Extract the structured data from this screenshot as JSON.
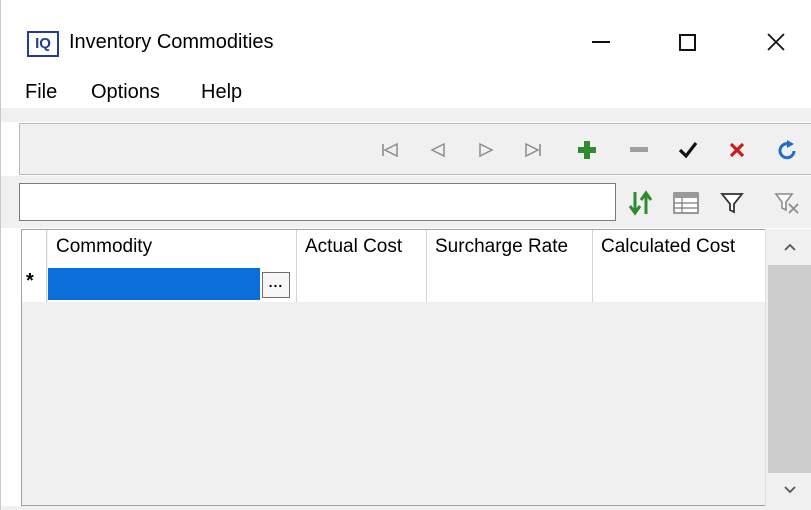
{
  "window": {
    "app_icon_text": "IQ",
    "title": "Inventory Commodities",
    "minimize_glyph": "—",
    "maximize_glyph": "☐",
    "close_glyph": "✕"
  },
  "menu": {
    "items": [
      "File",
      "Options",
      "Help"
    ]
  },
  "navigator": {
    "buttons": [
      {
        "name": "first-record-icon",
        "color": "#8c8c8c"
      },
      {
        "name": "prior-record-icon",
        "color": "#8c8c8c"
      },
      {
        "name": "next-record-icon",
        "color": "#8c8c8c"
      },
      {
        "name": "last-record-icon",
        "color": "#8c8c8c"
      },
      {
        "name": "insert-record-icon",
        "color": "#2e8b2e"
      },
      {
        "name": "delete-record-icon",
        "color": "#8c8c8c"
      },
      {
        "name": "post-edit-icon",
        "color": "#111111"
      },
      {
        "name": "cancel-edit-icon",
        "color": "#d01a1a"
      },
      {
        "name": "refresh-icon",
        "color": "#1f6fc8"
      }
    ]
  },
  "search": {
    "value": "",
    "placeholder": ""
  },
  "tools": [
    "sort-icon",
    "grid-view-icon",
    "filter-icon",
    "clear-filter-icon"
  ],
  "grid": {
    "columns": [
      "Commodity",
      "Actual Cost",
      "Surcharge Rate",
      "Calculated Cost"
    ],
    "new_row_marker": "*",
    "ellipsis": "...",
    "rows": []
  },
  "colors": {
    "selection": "#0a6fd8",
    "title_icon": "#1f3f8f"
  }
}
